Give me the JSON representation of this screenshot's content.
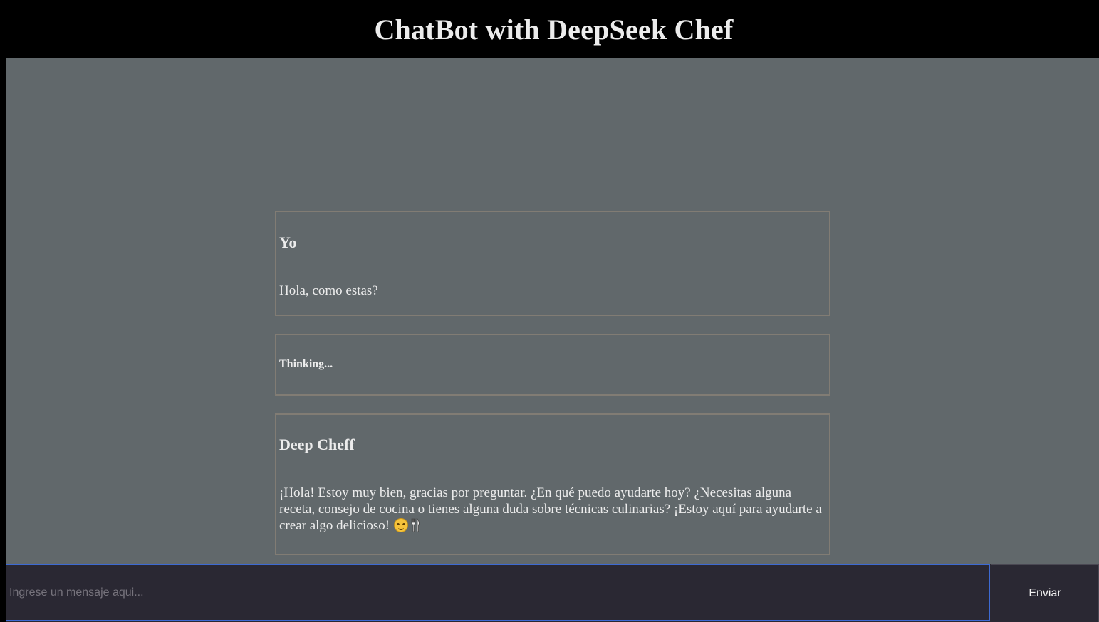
{
  "header": {
    "title": "ChatBot with DeepSeek Chef"
  },
  "messages": [
    {
      "role": "user",
      "sender": "Yo",
      "text": "Hola, como estas?"
    },
    {
      "role": "status",
      "text": "Thinking..."
    },
    {
      "role": "assistant",
      "sender": "Deep Cheff",
      "text": "¡Hola! Estoy muy bien, gracias por preguntar. ¿En qué puedo ayudarte hoy? ¿Necesitas alguna receta, consejo de cocina o tienes alguna duda sobre técnicas culinarias? ¡Estoy aquí para ayudarte a crear algo delicioso!",
      "emojis": [
        "smiling-face-icon",
        "fork-and-knife-icon"
      ]
    }
  ],
  "composer": {
    "value": "",
    "placeholder": "Ingrese un mensaje aqui...",
    "send_label": "Enviar"
  },
  "colors": {
    "header_bg": "#000000",
    "chat_bg": "#61686b",
    "message_border": "#817c74",
    "composer_bg": "#2a2833",
    "input_focus_border": "#3d6ad3",
    "text": "#ececec"
  }
}
